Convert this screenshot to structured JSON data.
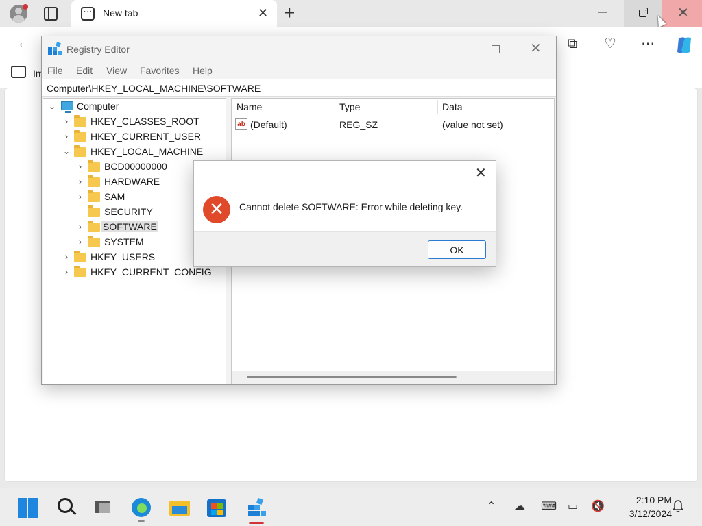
{
  "browser": {
    "tab_title": "New tab",
    "new_tab_glyph": "+",
    "bookmark_text": "Im"
  },
  "regedit": {
    "title": "Registry Editor",
    "menu": [
      "File",
      "Edit",
      "View",
      "Favorites",
      "Help"
    ],
    "address": "Computer\\HKEY_LOCAL_MACHINE\\SOFTWARE",
    "tree": {
      "root": "Computer",
      "hives": [
        {
          "label": "HKEY_CLASSES_ROOT"
        },
        {
          "label": "HKEY_CURRENT_USER"
        },
        {
          "label": "HKEY_LOCAL_MACHINE"
        },
        {
          "label": "HKEY_USERS"
        },
        {
          "label": "HKEY_CURRENT_CONFIG"
        }
      ],
      "hklm_children": [
        {
          "label": "BCD00000000"
        },
        {
          "label": "HARDWARE"
        },
        {
          "label": "SAM"
        },
        {
          "label": "SECURITY"
        },
        {
          "label": "SOFTWARE"
        },
        {
          "label": "SYSTEM"
        }
      ],
      "selected": "SOFTWARE"
    },
    "columns": [
      "Name",
      "Type",
      "Data"
    ],
    "values": [
      {
        "name": "(Default)",
        "type": "REG_SZ",
        "data": "(value not set)",
        "icon": "string-value-icon"
      }
    ]
  },
  "dialog": {
    "message": "Cannot delete SOFTWARE:  Error while deleting key.",
    "ok_label": "OK",
    "icon": "error-icon"
  },
  "taskbar": {
    "time": "2:10 PM",
    "date": "3/12/2024"
  },
  "colors": {
    "accent": "#2b79d0",
    "error": "#e04a2a",
    "folder": "#f6c94e",
    "close_hover": "#f0a8a8"
  }
}
